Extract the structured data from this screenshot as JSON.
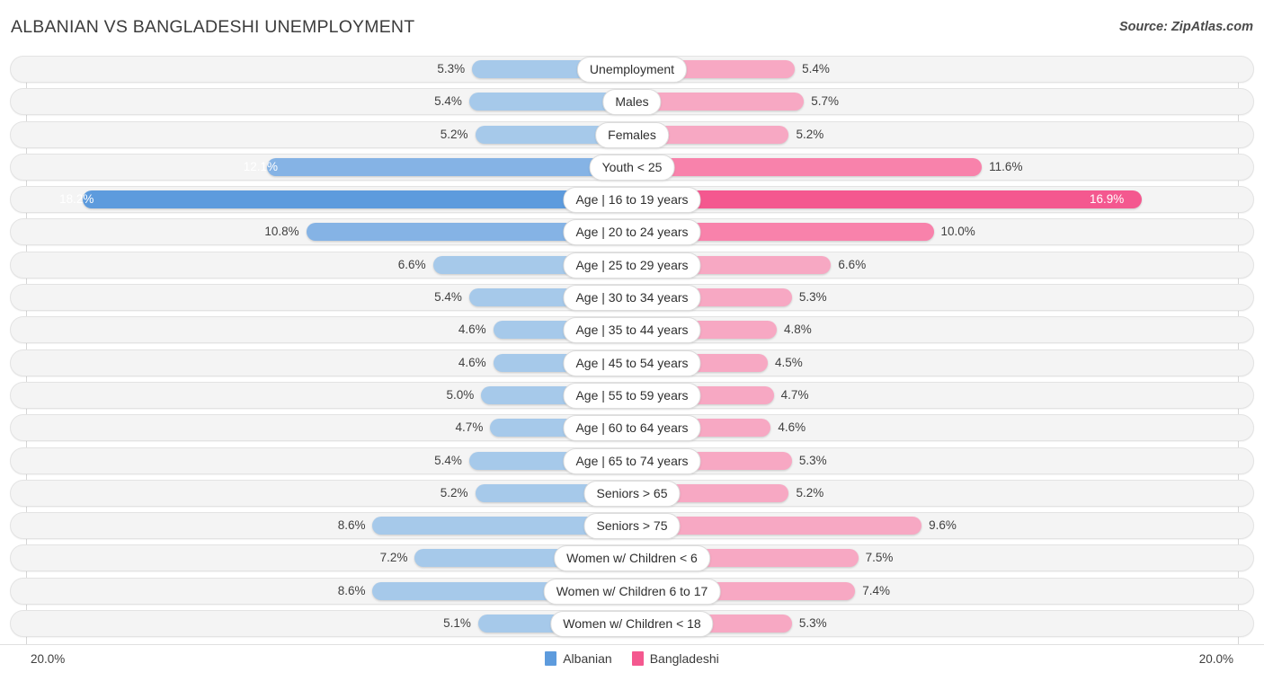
{
  "header": {
    "title": "ALBANIAN VS BANGLADESHI UNEMPLOYMENT",
    "source": "Source: ZipAtlas.com"
  },
  "footer": {
    "axis_left": "20.0%",
    "axis_right": "20.0%",
    "legend": [
      {
        "label": "Albanian",
        "color": "#5d9bdd"
      },
      {
        "label": "Bangladeshi",
        "color": "#f4588f"
      }
    ]
  },
  "chart_data": {
    "type": "bar",
    "title": "ALBANIAN VS BANGLADESHI UNEMPLOYMENT",
    "subtitle": "Source: ZipAtlas.com",
    "orientation": "horizontal-diverging",
    "xlabel": "",
    "ylabel": "",
    "xlim": [
      20.0,
      20.0
    ],
    "axis_max_left": 20.0,
    "axis_max_right": 20.0,
    "unit": "%",
    "grid": true,
    "legend_position": "bottom-center",
    "categories": [
      "Unemployment",
      "Males",
      "Females",
      "Youth < 25",
      "Age | 16 to 19 years",
      "Age | 20 to 24 years",
      "Age | 25 to 29 years",
      "Age | 30 to 34 years",
      "Age | 35 to 44 years",
      "Age | 45 to 54 years",
      "Age | 55 to 59 years",
      "Age | 60 to 64 years",
      "Age | 65 to 74 years",
      "Seniors > 65",
      "Seniors > 75",
      "Women w/ Children < 6",
      "Women w/ Children 6 to 17",
      "Women w/ Children < 18"
    ],
    "series": [
      {
        "name": "Albanian",
        "color": "#5d9bdd",
        "values": [
          5.3,
          5.4,
          5.2,
          12.1,
          18.2,
          10.8,
          6.6,
          5.4,
          4.6,
          4.6,
          5.0,
          4.7,
          5.4,
          5.2,
          8.6,
          7.2,
          8.6,
          5.1
        ],
        "labels": [
          "5.3%",
          "5.4%",
          "5.2%",
          "12.1%",
          "18.2%",
          "10.8%",
          "6.6%",
          "5.4%",
          "4.6%",
          "4.6%",
          "5.0%",
          "4.7%",
          "5.4%",
          "5.2%",
          "8.6%",
          "7.2%",
          "8.6%",
          "5.1%"
        ]
      },
      {
        "name": "Bangladeshi",
        "color": "#f4588f",
        "values": [
          5.4,
          5.7,
          5.2,
          11.6,
          16.9,
          10.0,
          6.6,
          5.3,
          4.8,
          4.5,
          4.7,
          4.6,
          5.3,
          5.2,
          9.6,
          7.5,
          7.4,
          5.3
        ],
        "labels": [
          "5.4%",
          "5.7%",
          "5.2%",
          "11.6%",
          "16.9%",
          "10.0%",
          "6.6%",
          "5.3%",
          "4.8%",
          "4.5%",
          "4.7%",
          "4.6%",
          "5.3%",
          "5.2%",
          "9.6%",
          "7.5%",
          "7.4%",
          "5.3%"
        ]
      }
    ],
    "row_emphasis": [
      "none",
      "none",
      "none",
      "mid",
      "hot",
      "mid",
      "none",
      "none",
      "none",
      "none",
      "none",
      "none",
      "none",
      "none",
      "none",
      "none",
      "none",
      "none"
    ],
    "label_inside": [
      [
        false,
        false
      ],
      [
        false,
        false
      ],
      [
        false,
        false
      ],
      [
        true,
        false
      ],
      [
        true,
        true
      ],
      [
        false,
        false
      ],
      [
        false,
        false
      ],
      [
        false,
        false
      ],
      [
        false,
        false
      ],
      [
        false,
        false
      ],
      [
        false,
        false
      ],
      [
        false,
        false
      ],
      [
        false,
        false
      ],
      [
        false,
        false
      ],
      [
        false,
        false
      ],
      [
        false,
        false
      ],
      [
        false,
        false
      ],
      [
        false,
        false
      ]
    ]
  }
}
